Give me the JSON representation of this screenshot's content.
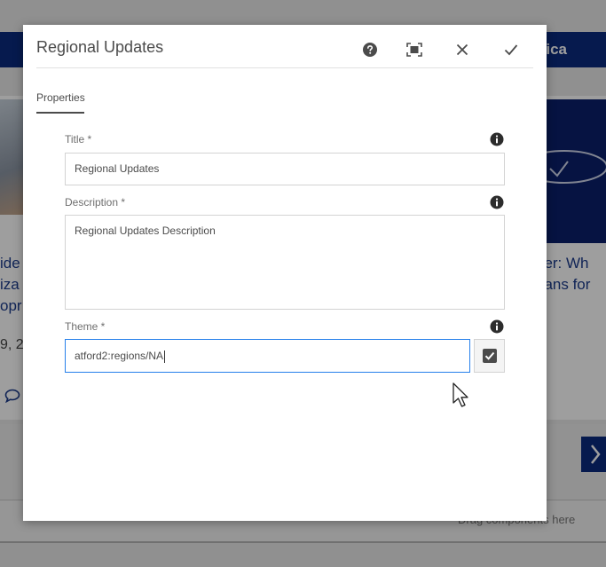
{
  "background": {
    "brand_partial": "ica",
    "card_left_lines": [
      "ide",
      "iza",
      "opr"
    ],
    "card_left_date": "9, 2",
    "card_right_lines": [
      "tter: Wh",
      "eans for"
    ],
    "drag_hint": "Drag components here"
  },
  "dialog": {
    "title": "Regional Updates",
    "header_icons": [
      "help-icon",
      "fullscreen-icon",
      "close-icon",
      "check-icon"
    ],
    "tab": "Properties",
    "fields": {
      "title": {
        "label": "Title *",
        "value": "Regional Updates"
      },
      "description": {
        "label": "Description *",
        "value": "Regional Updates Description"
      },
      "theme": {
        "label": "Theme *",
        "value": "atford2:regions/NA"
      }
    }
  },
  "colors": {
    "accent": "#2680eb",
    "nav_blue": "#0a2a7e",
    "text": "#4b4b4b"
  }
}
